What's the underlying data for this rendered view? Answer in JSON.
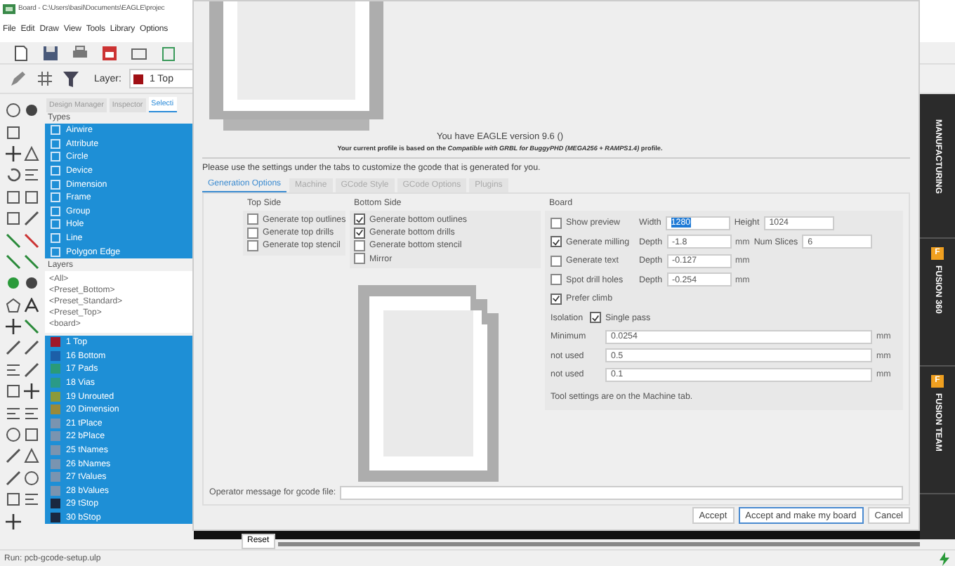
{
  "window": {
    "title": "Board - C:\\Users\\basil\\Documents\\EAGLE\\projec"
  },
  "menu": [
    "File",
    "Edit",
    "Draw",
    "View",
    "Tools",
    "Library",
    "Options"
  ],
  "toolbar": {
    "layer_label": "Layer:",
    "layer": {
      "name": "1 Top",
      "color": "#a00f14"
    }
  },
  "panel": {
    "tabs": [
      {
        "label": "Design Manager",
        "selected": false
      },
      {
        "label": "Inspector",
        "selected": false
      },
      {
        "label": "Selecti",
        "selected": true
      }
    ],
    "types_label": "Types",
    "types": [
      {
        "label": "Airwire",
        "selected": true
      },
      {
        "label": "Attribute",
        "selected": true
      },
      {
        "label": "Circle",
        "selected": true
      },
      {
        "label": "Device",
        "selected": true
      },
      {
        "label": "Dimension",
        "selected": true
      },
      {
        "label": "Frame",
        "selected": true
      },
      {
        "label": "Group",
        "selected": true
      },
      {
        "label": "Hole",
        "selected": true
      },
      {
        "label": "Line",
        "selected": true
      },
      {
        "label": "Polygon Edge",
        "selected": true
      }
    ],
    "layers_label": "Layers",
    "presets": [
      {
        "label": "<All>",
        "selected": false
      },
      {
        "label": "<Preset_Bottom>",
        "selected": false
      },
      {
        "label": "<Preset_Standard>",
        "selected": false
      },
      {
        "label": "<Preset_Top>",
        "selected": false
      },
      {
        "label": "<board>",
        "selected": false
      }
    ],
    "layers": [
      {
        "label": "1 Top",
        "color": "#a0182a",
        "selected": true
      },
      {
        "label": "16 Bottom",
        "color": "#1c5fa8",
        "selected": true
      },
      {
        "label": "17 Pads",
        "color": "#2a9a78",
        "selected": true
      },
      {
        "label": "18 Vias",
        "color": "#2a9a88",
        "selected": true
      },
      {
        "label": "19 Unrouted",
        "color": "#8c9a3a",
        "selected": true
      },
      {
        "label": "20 Dimension",
        "color": "#9a8a3a",
        "selected": true
      },
      {
        "label": "21 tPlace",
        "color": "#7a94b0",
        "selected": true
      },
      {
        "label": "22 bPlace",
        "color": "#7a94b0",
        "selected": true
      },
      {
        "label": "25 tNames",
        "color": "#7a94b0",
        "selected": true
      },
      {
        "label": "26 bNames",
        "color": "#7a94b0",
        "selected": true
      },
      {
        "label": "27 tValues",
        "color": "#7a94b0",
        "selected": true
      },
      {
        "label": "28 bValues",
        "color": "#7a94b0",
        "selected": true
      },
      {
        "label": "29 tStop",
        "color": "#1a2840",
        "selected": true
      },
      {
        "label": "30 bStop",
        "color": "#1a2840",
        "selected": true
      }
    ],
    "reset": "Reset"
  },
  "side_tabs": [
    {
      "label": "MANUFACTURING"
    },
    {
      "label": "FUSION 360",
      "badge": "F"
    },
    {
      "label": "FUSION TEAM",
      "badge": "F"
    }
  ],
  "status": "Run: pcb-gcode-setup.ulp",
  "dialog": {
    "version": "You have EAGLE version 9.6 ()",
    "profile": "Your current profile is based on the *Compatible with GRBL for BuggyPHD (MEGA256 + RAMPS1.4)* profile.",
    "instructions": "Please use the settings under the tabs to customize the gcode that is generated for you.",
    "tabs": [
      {
        "label": "Generation Options",
        "selected": true
      },
      {
        "label": "Machine",
        "selected": false
      },
      {
        "label": "GCode Style",
        "selected": false
      },
      {
        "label": "GCode Options",
        "selected": false
      },
      {
        "label": "Plugins",
        "selected": false
      }
    ],
    "top_side": {
      "title": "Top Side",
      "options": [
        {
          "label": "Generate top outlines",
          "checked": false
        },
        {
          "label": "Generate top drills",
          "checked": false
        },
        {
          "label": "Generate top stencil",
          "checked": false
        }
      ]
    },
    "bottom_side": {
      "title": "Bottom Side",
      "options": [
        {
          "label": "Generate bottom outlines",
          "checked": true
        },
        {
          "label": "Generate bottom drills",
          "checked": true
        },
        {
          "label": "Generate bottom stencil",
          "checked": false
        },
        {
          "label": "Mirror",
          "checked": false
        }
      ]
    },
    "board": {
      "title": "Board",
      "rows": [
        {
          "kind": "option",
          "label": "Show preview",
          "checked": false,
          "fields": [
            {
              "label": "Width",
              "value": "1280",
              "selected": true
            },
            {
              "label": "Height",
              "value": "1024",
              "selected": false
            }
          ]
        },
        {
          "kind": "option",
          "label": "Generate milling",
          "checked": true,
          "fields": [
            {
              "label": "Depth",
              "value": "-1.8",
              "unit": "mm",
              "selected": false
            },
            {
              "label": "Num Slices",
              "value": "6",
              "selected": false
            }
          ]
        },
        {
          "kind": "option",
          "label": "Generate text",
          "checked": false,
          "fields": [
            {
              "label": "Depth",
              "value": "-0.127",
              "unit": "mm",
              "selected": false
            }
          ]
        },
        {
          "kind": "option",
          "label": "Spot drill holes",
          "checked": false,
          "fields": [
            {
              "label": "Depth",
              "value": "-0.254",
              "unit": "mm",
              "selected": false
            }
          ]
        },
        {
          "kind": "option",
          "label": "Prefer climb",
          "checked": true,
          "fields": []
        },
        {
          "kind": "isolation",
          "label": "Isolation",
          "option": {
            "label": "Single pass",
            "checked": true
          }
        },
        {
          "kind": "wide",
          "label": "Minimum",
          "value": "0.0254",
          "unit": "mm"
        },
        {
          "kind": "wide",
          "label": "not used",
          "value": "0.5",
          "unit": "mm"
        },
        {
          "kind": "wide",
          "label": "not used",
          "value": "0.1",
          "unit": "mm"
        },
        {
          "kind": "note",
          "label": "Tool settings are on the Machine tab."
        }
      ]
    },
    "operator_label": "Operator message for gcode file:",
    "buttons": [
      {
        "label": "Accept",
        "default": false
      },
      {
        "label": "Accept and make my board",
        "default": true
      },
      {
        "label": "Cancel",
        "default": false
      }
    ]
  }
}
